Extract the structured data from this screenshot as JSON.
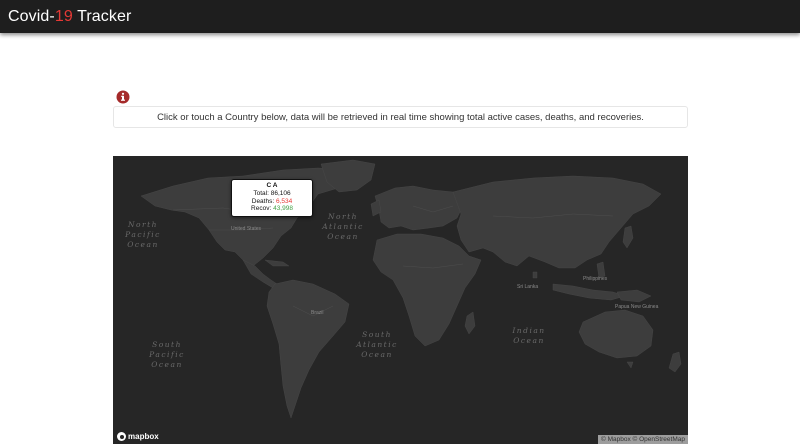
{
  "navbar": {
    "brand_prefix": "Covid-",
    "brand_accent": "19",
    "brand_suffix": " Tracker"
  },
  "info": {
    "icon": "info-circle-icon",
    "icon_color": "#a52a2a",
    "text": "Click or touch a Country below, data will be retrieved in real time showing total active cases, deaths, and recoveries."
  },
  "map": {
    "ocean_labels": {
      "north_pacific": "North\nPacific\nOcean",
      "north_atlantic": "North\nAtlantic\nOcean",
      "south_atlantic": "South\nAtlantic\nOcean",
      "indian": "Indian\nOcean",
      "south_pacific": "South\nPacific\nOcean"
    },
    "places": {
      "united_states": "United States",
      "brazil": "Brazil",
      "sri_lanka": "Sri Lanka",
      "philippines": "Philippines",
      "papua": "Papua New Guinea"
    },
    "tooltip": {
      "title": "C A",
      "total_label": "Total: ",
      "total_value": "86,106",
      "deaths_label": "Deaths: ",
      "deaths_value": "6,534",
      "recov_label": "Recov: ",
      "recov_value": "43,998"
    },
    "logo_text": "mapbox",
    "attribution": "© Mapbox © OpenStreetMap"
  },
  "colors": {
    "navbar_bg": "#1e1e1e",
    "accent_red": "#e53935",
    "recov_green": "#43a047",
    "map_bg": "#262626",
    "land": "#3d3d3d"
  }
}
